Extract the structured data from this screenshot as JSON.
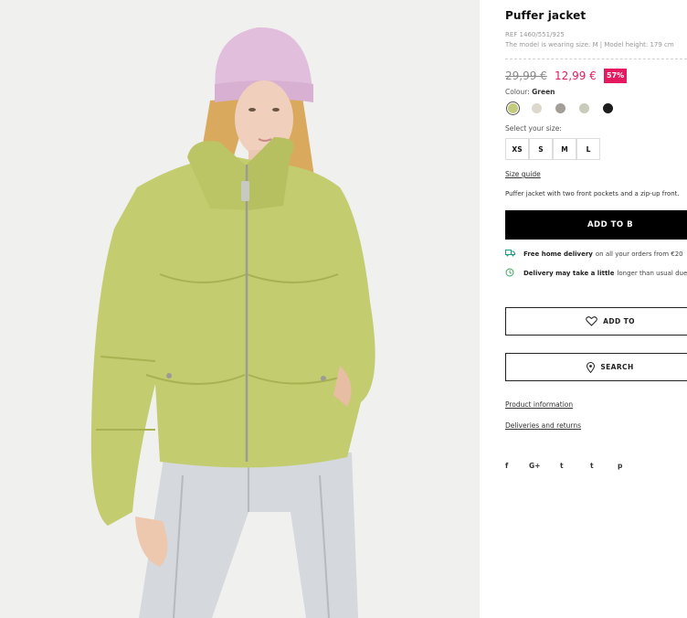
{
  "product": {
    "title": "Puffer jacket",
    "ref": "REF 1460/551/925",
    "model_info": "The model is wearing size: M | Model height: 179 cm",
    "description": "Puffer jacket with two front pockets and a zip-up front."
  },
  "price": {
    "old": "29,99 €",
    "new": "12,99 €",
    "discount": "57%"
  },
  "colour": {
    "label": "Colour:",
    "selected": "Green",
    "swatches": [
      {
        "name": "green",
        "color": "#c3cc7d",
        "selected": true
      },
      {
        "name": "cream",
        "color": "#dcd8cb",
        "selected": false
      },
      {
        "name": "grey-mixed",
        "color": "#a39e97",
        "selected": false
      },
      {
        "name": "sage",
        "color": "#c8ccba",
        "selected": false
      },
      {
        "name": "black",
        "color": "#1d1d1d",
        "selected": false
      }
    ]
  },
  "sizes": {
    "label": "Select your size:",
    "options": [
      "XS",
      "S",
      "M",
      "L"
    ]
  },
  "size_guide": "Size guide",
  "add_to_cart": "ADD TO B",
  "delivery": {
    "free_bold": "Free home delivery",
    "free_rest": "on all your orders from €20",
    "delay_bold": "Delivery may take a little",
    "delay_rest": "longer than usual due"
  },
  "buttons": {
    "wishlist": "ADD TO",
    "store": "SEARCH"
  },
  "links": {
    "product_info": "Product information",
    "deliveries": "Deliveries and returns"
  },
  "social": [
    "f",
    "G+",
    "t",
    "t",
    "p"
  ],
  "colors": {
    "accent": "#e5195f",
    "jacket": "#c3cc6f"
  }
}
